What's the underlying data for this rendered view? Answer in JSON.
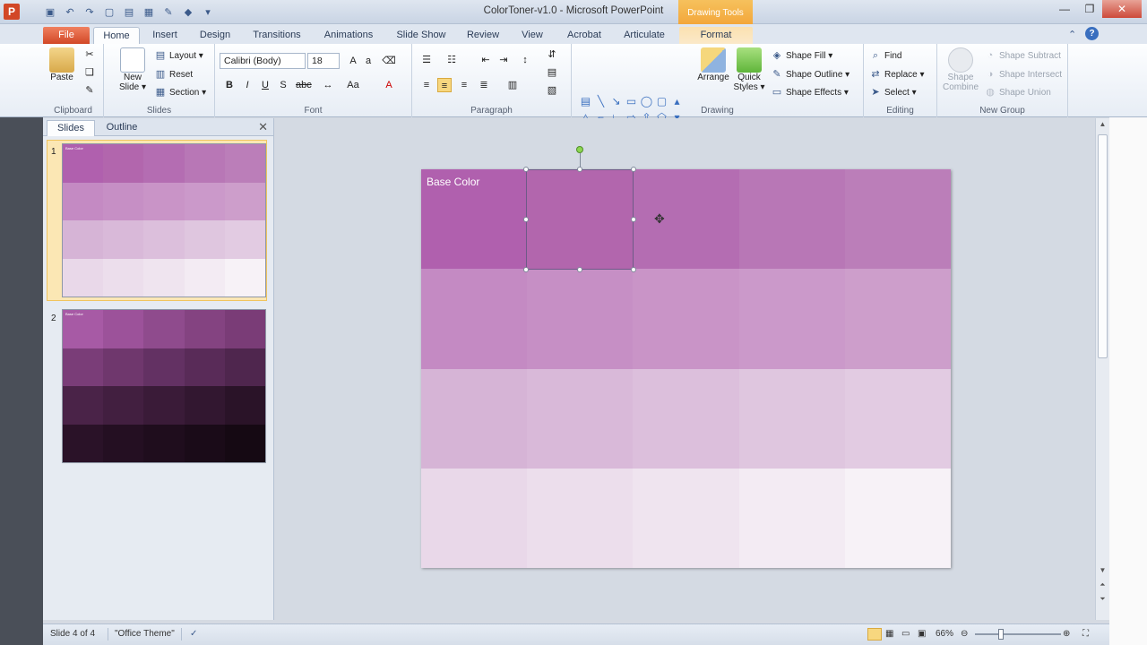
{
  "window": {
    "title": "ColorToner-v1.0 - Microsoft PowerPoint",
    "context_tab_group": "Drawing Tools",
    "logo_letter": "P"
  },
  "tabs": [
    "File",
    "Home",
    "Insert",
    "Design",
    "Transitions",
    "Animations",
    "Slide Show",
    "Review",
    "View",
    "Acrobat",
    "Articulate",
    "Format"
  ],
  "ribbon": {
    "clipboard": {
      "label": "Clipboard",
      "paste": "Paste"
    },
    "slides": {
      "label": "Slides",
      "new_slide": "New Slide ▾",
      "layout": "Layout ▾",
      "reset": "Reset",
      "section": "Section ▾"
    },
    "font": {
      "label": "Font",
      "font_name": "Calibri (Body)",
      "font_size": "18"
    },
    "paragraph": {
      "label": "Paragraph"
    },
    "drawing": {
      "label": "Drawing",
      "arrange": "Arrange",
      "quick_styles": "Quick Styles ▾",
      "shape_fill": "Shape Fill ▾",
      "shape_outline": "Shape Outline ▾",
      "shape_effects": "Shape Effects ▾"
    },
    "editing": {
      "label": "Editing",
      "find": "Find",
      "replace": "Replace ▾",
      "select": "Select ▾"
    },
    "new_group": {
      "label": "New Group",
      "shape_combine": "Shape Combine",
      "shape_subtract": "Shape Subtract",
      "shape_intersect": "Shape Intersect",
      "shape_union": "Shape Union"
    }
  },
  "left_pane": {
    "tab_slides": "Slides",
    "tab_outline": "Outline",
    "slide1_number": "1",
    "slide2_number": "2",
    "thumb_label": "Base Color"
  },
  "slide": {
    "title": "Base Color",
    "colors": [
      [
        "#b060ae",
        "#b266ad",
        "#b46db2",
        "#b877b6",
        "#bb7eb9"
      ],
      [
        "#c48ac3",
        "#c68fc5",
        "#c994c7",
        "#cb99ca",
        "#cd9ecb"
      ],
      [
        "#d6b4d6",
        "#d9b9d9",
        "#dcbfdc",
        "#dfc6df",
        "#e2cbe2"
      ],
      [
        "#e9d8e9",
        "#ecdeec",
        "#efe4ef",
        "#f3ebf3",
        "#f7f2f7"
      ]
    ]
  },
  "slide2": {
    "colors": [
      [
        "#a75aa5",
        "#9c529a",
        "#8f4b8d",
        "#844381",
        "#7a3c77"
      ],
      [
        "#7a3d78",
        "#6f376d",
        "#633163",
        "#592b58",
        "#4f264e"
      ],
      [
        "#4a2348",
        "#421f40",
        "#3a1b38",
        "#321730",
        "#2a1328"
      ],
      [
        "#2a1228",
        "#240f22",
        "#1f0d1d",
        "#1a0b18",
        "#150913"
      ]
    ]
  },
  "status": {
    "slide_of": "Slide 4 of 4",
    "theme": "\"Office Theme\"",
    "zoom": "66%"
  }
}
